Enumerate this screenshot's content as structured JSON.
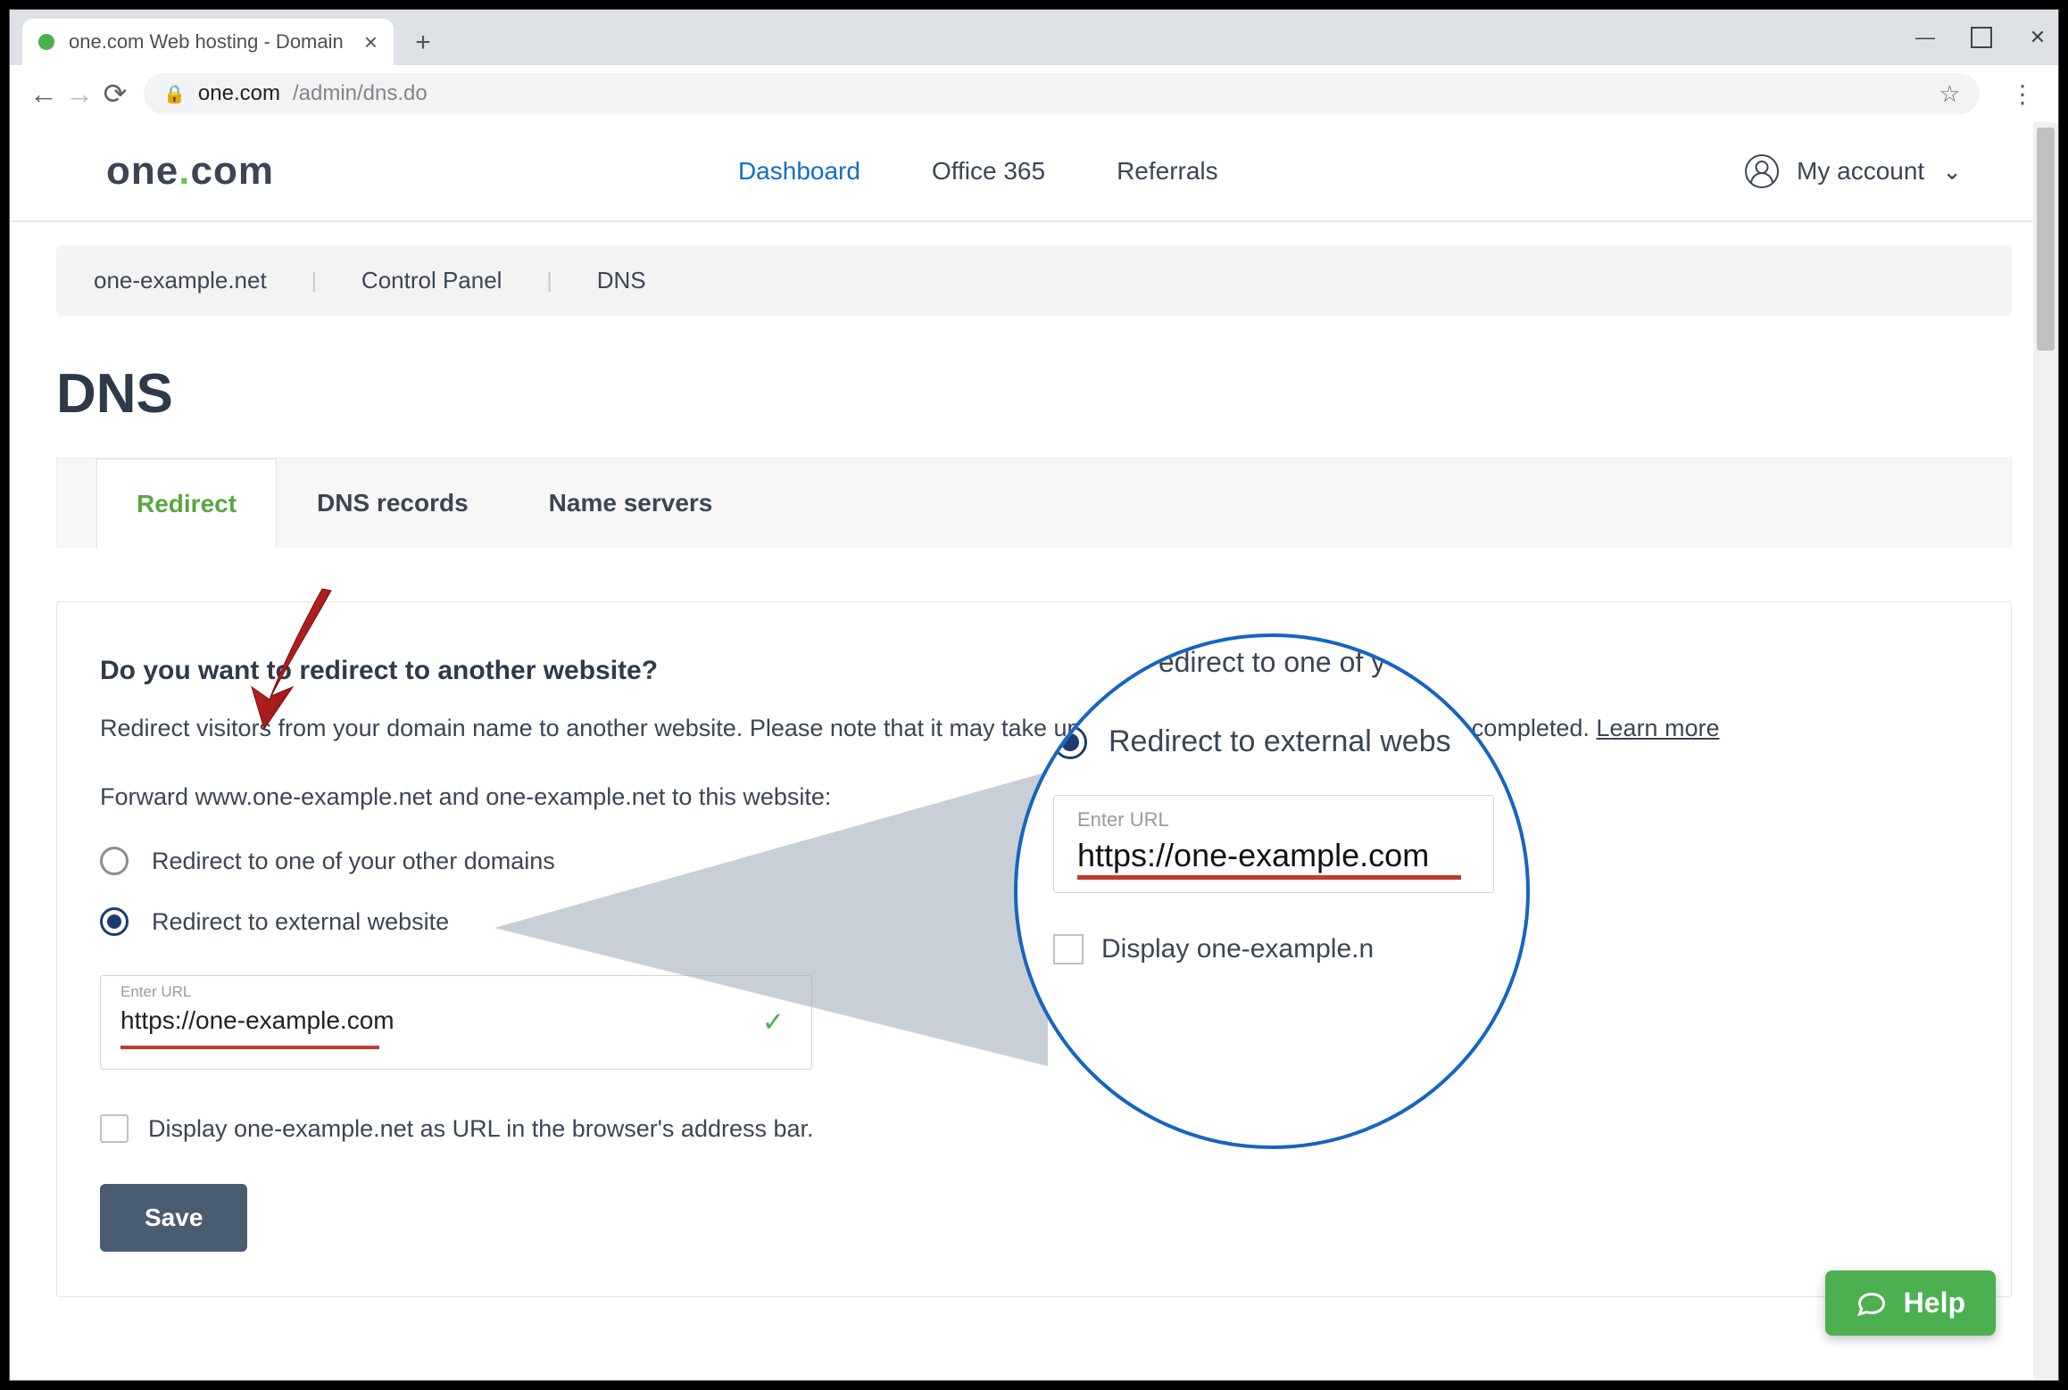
{
  "browser": {
    "tab_title": "one.com Web hosting  -  Domain",
    "url_host": "one.com",
    "url_path": "/admin/dns.do"
  },
  "header": {
    "logo_text": "one.com",
    "nav": [
      "Dashboard",
      "Office 365",
      "Referrals"
    ],
    "account_label": "My account"
  },
  "breadcrumb": [
    "one-example.net",
    "Control Panel",
    "DNS"
  ],
  "page_title": "DNS",
  "tabs": [
    "Redirect",
    "DNS records",
    "Name servers"
  ],
  "active_tab": 0,
  "panel": {
    "heading": "Do you want to redirect to another website?",
    "description": "Redirect visitors from your domain name to another website. Please note that it may take up to 90 minutes for the changes to be completed. ",
    "learn_more": "Learn more",
    "forward_line": "Forward www.one-example.net and one-example.net to this website:",
    "radio_other": "Redirect to one of your other domains",
    "radio_external": "Redirect to external website",
    "url_label": "Enter URL",
    "url_value": "https://one-example.com",
    "display_checkbox": "Display one-example.net as URL in the browser's address bar.",
    "save": "Save"
  },
  "zoom": {
    "top_fragment": "edirect to one of y",
    "radio_line": "Redirect to external webs",
    "url_label": "Enter URL",
    "url_value": "https://one-example.com",
    "display_fragment": "Display one-example.n"
  },
  "help_label": "Help"
}
